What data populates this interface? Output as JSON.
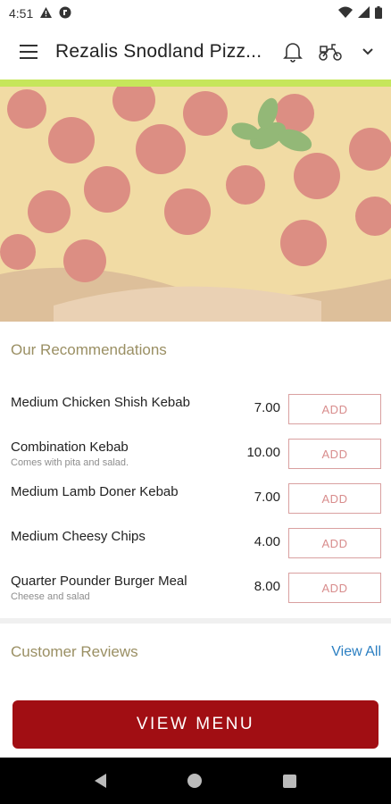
{
  "status_bar": {
    "time": "4:51",
    "icons": [
      "alert-icon",
      "vpn-icon",
      "wifi-icon",
      "signal-icon",
      "battery-icon"
    ]
  },
  "app_bar": {
    "title": "Rezalis Snodland Pizz...",
    "icons": [
      "menu-icon",
      "bell-icon",
      "delivery-scooter-icon",
      "chevron-down-icon"
    ]
  },
  "colors": {
    "accent": "#c6e65b",
    "brand": "#a10e13",
    "section_title": "#9a8f63",
    "link": "#2b7fc2"
  },
  "hero": {
    "image": "pepperoni-pizza-photo"
  },
  "recommendations": {
    "title": "Our Recommendations",
    "items": [
      {
        "name": "Medium Chicken Shish Kebab",
        "description": "",
        "price": "7.00",
        "add_label": "ADD"
      },
      {
        "name": "Combination Kebab",
        "description": "Comes with pita and salad.",
        "price": "10.00",
        "add_label": "ADD"
      },
      {
        "name": "Medium Lamb Doner Kebab",
        "description": "",
        "price": "7.00",
        "add_label": "ADD"
      },
      {
        "name": "Medium Cheesy Chips",
        "description": "",
        "price": "4.00",
        "add_label": "ADD"
      },
      {
        "name": "Quarter Pounder Burger Meal",
        "description": "Cheese and salad",
        "price": "8.00",
        "add_label": "ADD"
      }
    ]
  },
  "reviews": {
    "title": "Customer Reviews",
    "view_all": "View All"
  },
  "view_menu_label": "VIEW MENU",
  "nav_bar": {
    "icons": [
      "back-icon",
      "home-icon",
      "recents-icon"
    ]
  }
}
